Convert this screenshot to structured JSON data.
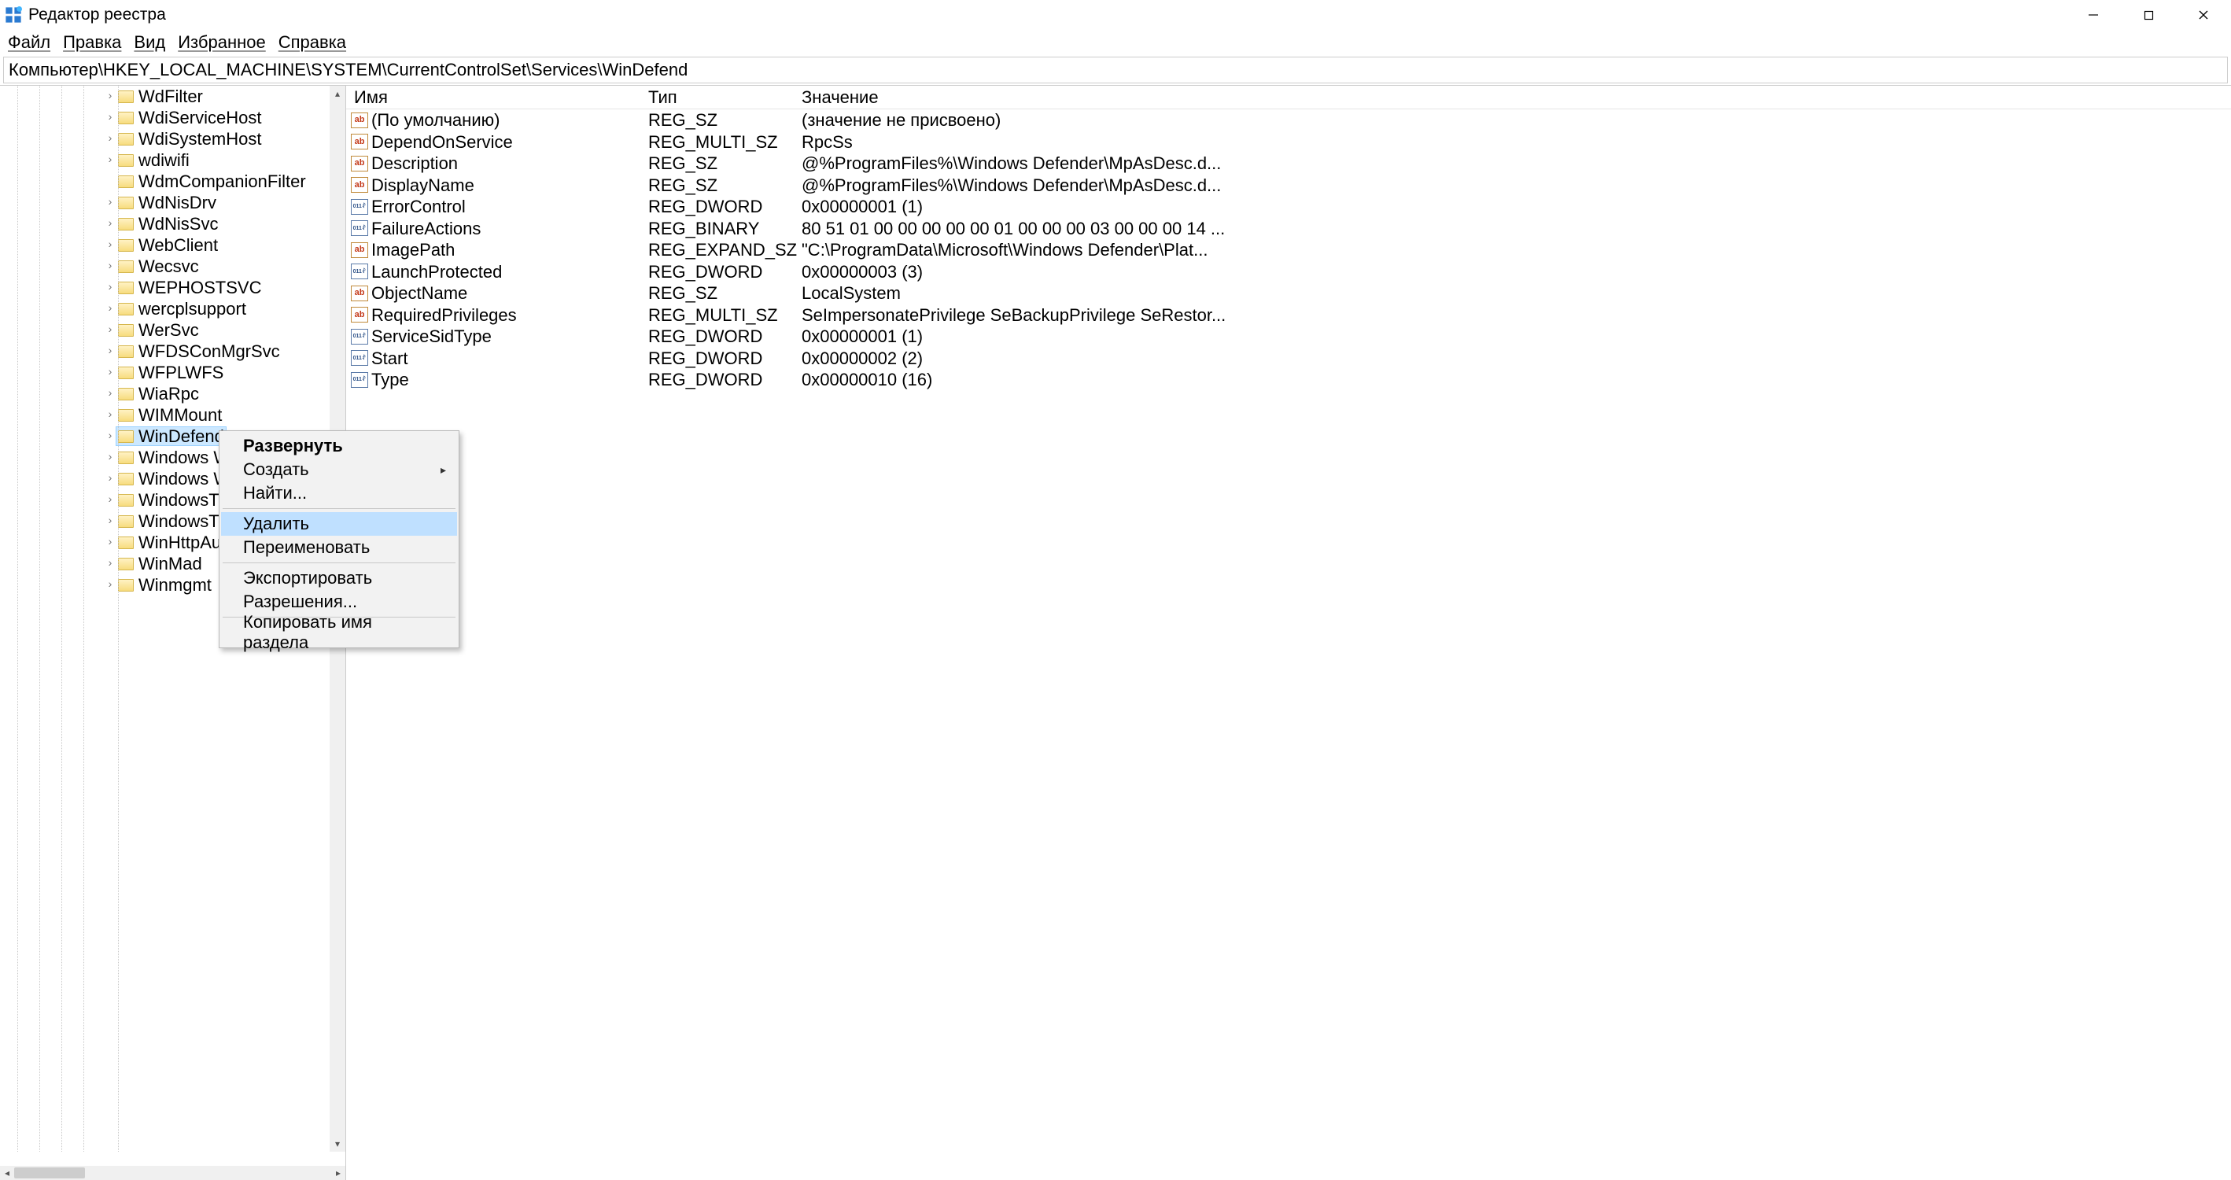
{
  "window": {
    "title": "Редактор реестра"
  },
  "menu": {
    "file": "Файл",
    "edit": "Правка",
    "view": "Вид",
    "favorites": "Избранное",
    "help": "Справка"
  },
  "address": "Компьютер\\HKEY_LOCAL_MACHINE\\SYSTEM\\CurrentControlSet\\Services\\WinDefend",
  "columns": {
    "name": "Имя",
    "type": "Тип",
    "data": "Значение"
  },
  "tree": [
    {
      "label": "WdFilter",
      "expandable": true
    },
    {
      "label": "WdiServiceHost",
      "expandable": true
    },
    {
      "label": "WdiSystemHost",
      "expandable": true
    },
    {
      "label": "wdiwifi",
      "expandable": true
    },
    {
      "label": "WdmCompanionFilter",
      "expandable": false
    },
    {
      "label": "WdNisDrv",
      "expandable": true
    },
    {
      "label": "WdNisSvc",
      "expandable": true
    },
    {
      "label": "WebClient",
      "expandable": true
    },
    {
      "label": "Wecsvc",
      "expandable": true
    },
    {
      "label": "WEPHOSTSVC",
      "expandable": true
    },
    {
      "label": "wercplsupport",
      "expandable": true
    },
    {
      "label": "WerSvc",
      "expandable": true
    },
    {
      "label": "WFDSConMgrSvc",
      "expandable": true
    },
    {
      "label": "WFPLWFS",
      "expandable": true
    },
    {
      "label": "WiaRpc",
      "expandable": true
    },
    {
      "label": "WIMMount",
      "expandable": true
    },
    {
      "label": "WinDefend",
      "expandable": true,
      "selected": true
    },
    {
      "label": "Windows W",
      "expandable": true
    },
    {
      "label": "Windows W",
      "expandable": true
    },
    {
      "label": "WindowsTr",
      "expandable": true
    },
    {
      "label": "WindowsTr",
      "expandable": true
    },
    {
      "label": "WinHttpAu",
      "expandable": true
    },
    {
      "label": "WinMad",
      "expandable": true
    },
    {
      "label": "Winmgmt",
      "expandable": true
    }
  ],
  "values": [
    {
      "icon": "str",
      "name": "(По умолчанию)",
      "type": "REG_SZ",
      "data": "(значение не присвоено)"
    },
    {
      "icon": "str",
      "name": "DependOnService",
      "type": "REG_MULTI_SZ",
      "data": "RpcSs"
    },
    {
      "icon": "str",
      "name": "Description",
      "type": "REG_SZ",
      "data": "@%ProgramFiles%\\Windows Defender\\MpAsDesc.d..."
    },
    {
      "icon": "str",
      "name": "DisplayName",
      "type": "REG_SZ",
      "data": "@%ProgramFiles%\\Windows Defender\\MpAsDesc.d..."
    },
    {
      "icon": "bin",
      "name": "ErrorControl",
      "type": "REG_DWORD",
      "data": "0x00000001 (1)"
    },
    {
      "icon": "bin",
      "name": "FailureActions",
      "type": "REG_BINARY",
      "data": "80 51 01 00 00 00 00 00 01 00 00 00 03 00 00 00 14 ..."
    },
    {
      "icon": "str",
      "name": "ImagePath",
      "type": "REG_EXPAND_SZ",
      "data": "\"C:\\ProgramData\\Microsoft\\Windows Defender\\Plat..."
    },
    {
      "icon": "bin",
      "name": "LaunchProtected",
      "type": "REG_DWORD",
      "data": "0x00000003 (3)"
    },
    {
      "icon": "str",
      "name": "ObjectName",
      "type": "REG_SZ",
      "data": "LocalSystem"
    },
    {
      "icon": "str",
      "name": "RequiredPrivileges",
      "type": "REG_MULTI_SZ",
      "data": "SeImpersonatePrivilege SeBackupPrivilege SeRestor..."
    },
    {
      "icon": "bin",
      "name": "ServiceSidType",
      "type": "REG_DWORD",
      "data": "0x00000001 (1)"
    },
    {
      "icon": "bin",
      "name": "Start",
      "type": "REG_DWORD",
      "data": "0x00000002 (2)"
    },
    {
      "icon": "bin",
      "name": "Type",
      "type": "REG_DWORD",
      "data": "0x00000010 (16)"
    }
  ],
  "ctx": {
    "expand": "Развернуть",
    "new": "Создать",
    "find": "Найти...",
    "delete": "Удалить",
    "rename": "Переименовать",
    "export": "Экспортировать",
    "permissions": "Разрешения...",
    "copyKeyName": "Копировать имя раздела"
  }
}
